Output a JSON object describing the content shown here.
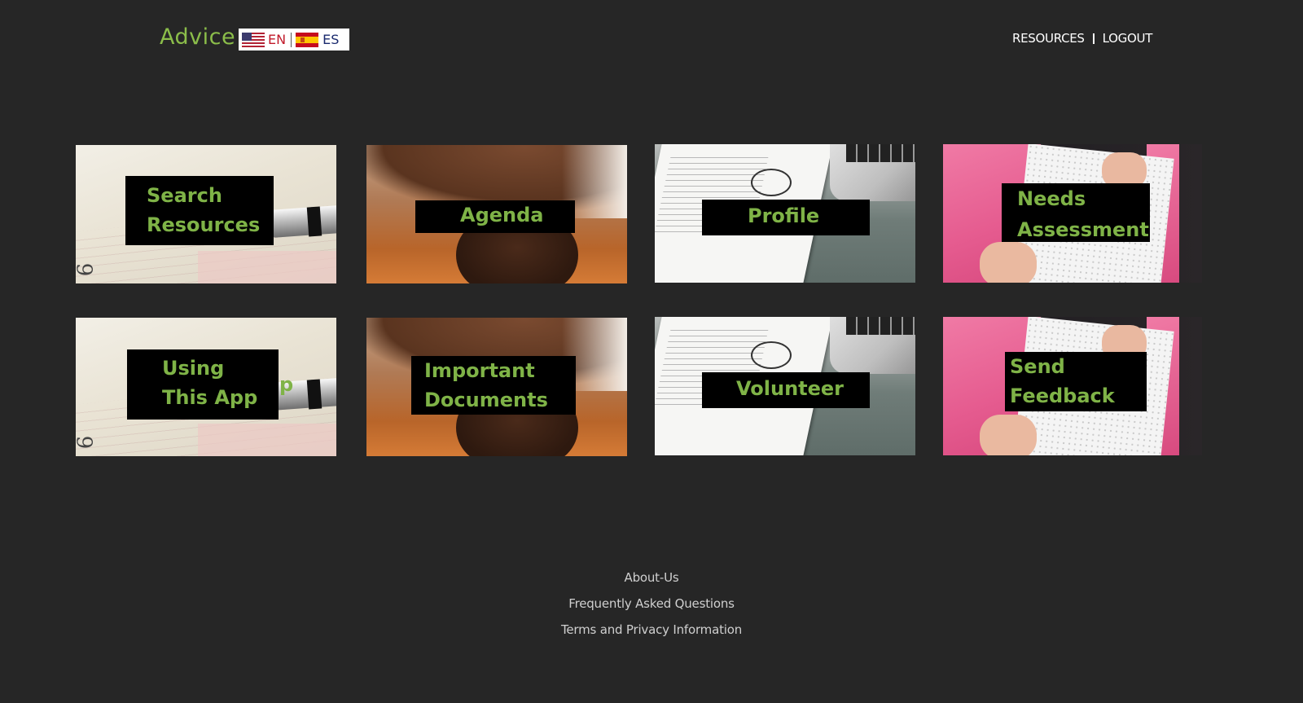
{
  "header": {
    "brand": "Advice",
    "languages": [
      {
        "code": "EN",
        "flag": "us-flag-icon",
        "color": "#c11b2b"
      },
      {
        "code": "ES",
        "flag": "spain-flag-icon",
        "color": "#1a2a6e"
      }
    ],
    "nav": {
      "resources": "RESOURCES",
      "logout": "LOGOUT"
    }
  },
  "tiles": [
    {
      "lines": [
        "Search",
        "Resources"
      ],
      "image": "paper-and-pen"
    },
    {
      "lines": [
        "Agenda"
      ],
      "image": "handshake"
    },
    {
      "lines": [
        "Profile"
      ],
      "image": "desk-with-glasses"
    },
    {
      "lines": [
        "Needs",
        "Assessment"
      ],
      "image": "woman-with-notebook"
    },
    {
      "lines": [
        "Using",
        "This App"
      ],
      "image": "paper-and-pen",
      "overflow_text": "p"
    },
    {
      "lines": [
        "Important",
        "Documents"
      ],
      "image": "handshake"
    },
    {
      "lines": [
        "Volunteer"
      ],
      "image": "desk-with-glasses"
    },
    {
      "lines": [
        "Send",
        "Feedback"
      ],
      "image": "woman-with-notebook"
    }
  ],
  "footer": {
    "about": "About-Us",
    "faq": "Frequently Asked Questions",
    "terms": "Terms and Privacy Information"
  },
  "colors": {
    "background": "#262626",
    "accent_green": "#7fb347",
    "label_bg": "#000000"
  }
}
